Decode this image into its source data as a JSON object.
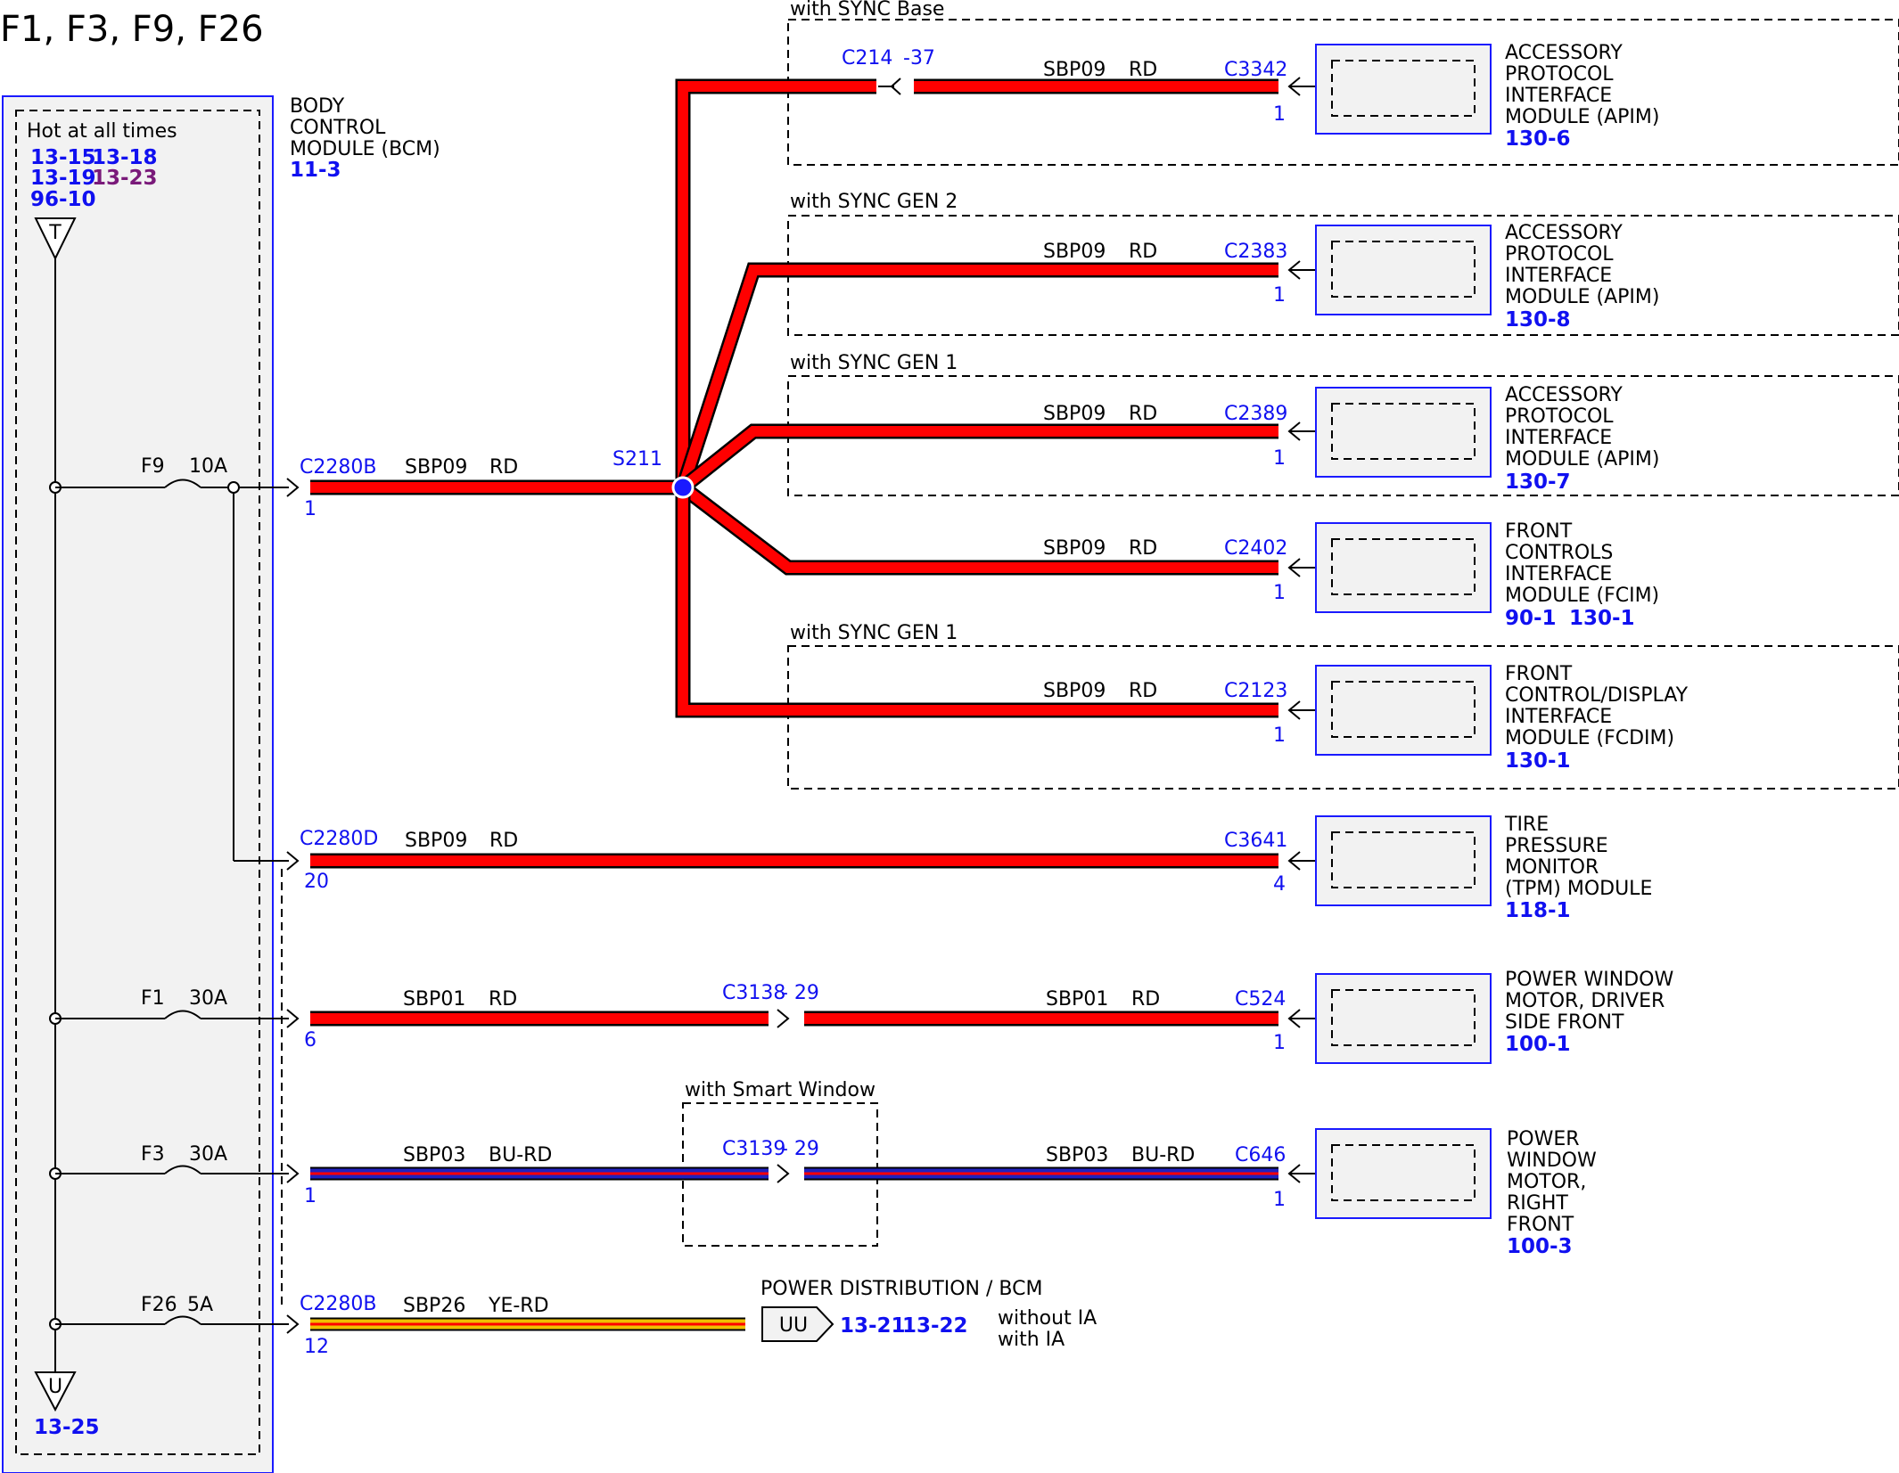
{
  "title": "F1, F3, F9, F26",
  "bcm": {
    "hot_label": "Hot at all times",
    "refs": [
      "13-15",
      "13-18",
      "13-19",
      "13-23",
      "96-10"
    ],
    "name_lines": [
      "BODY",
      "CONTROL",
      "MODULE (BCM)"
    ],
    "page_ref": "11-3",
    "top_terminal": "T",
    "bottom_terminal": "U",
    "bottom_ref": "13-25"
  },
  "fuses": [
    {
      "name": "F9",
      "rating": "10A"
    },
    {
      "name": "F1",
      "rating": "30A"
    },
    {
      "name": "F3",
      "rating": "30A"
    },
    {
      "name": "F26",
      "rating": "5A"
    }
  ],
  "splice": "S211",
  "option_groups": [
    "with SYNC Base",
    "with SYNC GEN 2",
    "with SYNC GEN 1",
    "with SYNC GEN 1",
    "with Smart Window"
  ],
  "branches": [
    {
      "circuit": "SBP09",
      "color": "RD",
      "inline_connector": "C214",
      "inline_pin": "-37",
      "connector": "C3342",
      "pin": "1",
      "module_lines": [
        "ACCESSORY",
        "PROTOCOL",
        "INTERFACE",
        "MODULE (APIM)"
      ],
      "refs": [
        "130-6"
      ]
    },
    {
      "circuit": "SBP09",
      "color": "RD",
      "connector": "C2383",
      "pin": "1",
      "module_lines": [
        "ACCESSORY",
        "PROTOCOL",
        "INTERFACE",
        "MODULE (APIM)"
      ],
      "refs": [
        "130-8"
      ]
    },
    {
      "circuit": "SBP09",
      "color": "RD",
      "connector": "C2389",
      "pin": "1",
      "module_lines": [
        "ACCESSORY",
        "PROTOCOL",
        "INTERFACE",
        "MODULE (APIM)"
      ],
      "refs": [
        "130-7"
      ]
    },
    {
      "circuit": "SBP09",
      "color": "RD",
      "connector": "C2402",
      "pin": "1",
      "module_lines": [
        "FRONT",
        "CONTROLS",
        "INTERFACE",
        "MODULE (FCIM)"
      ],
      "refs": [
        "90-1",
        "130-1"
      ]
    },
    {
      "circuit": "SBP09",
      "color": "RD",
      "connector": "C2123",
      "pin": "1",
      "module_lines": [
        "FRONT",
        "CONTROL/DISPLAY",
        "INTERFACE",
        "MODULE (FCDIM)"
      ],
      "refs": [
        "130-1"
      ]
    }
  ],
  "bcm_circuits": [
    {
      "bcm_connector": "C2280B",
      "bcm_pin": "1",
      "circuit": "SBP09",
      "color": "RD"
    },
    {
      "bcm_connector": "C2280D",
      "bcm_pin": "20",
      "circuit": "SBP09",
      "color": "RD",
      "connector": "C3641",
      "pin": "4",
      "module_lines": [
        "TIRE",
        "PRESSURE",
        "MONITOR",
        "(TPM) MODULE"
      ],
      "refs": [
        "118-1"
      ]
    },
    {
      "bcm_pin": "6",
      "circuit": "SBP01",
      "color": "RD",
      "inline_connector": "C3138",
      "inline_pin": "- 29",
      "circuit2": "SBP01",
      "color2": "RD",
      "connector": "C524",
      "pin": "1",
      "module_lines": [
        "POWER WINDOW",
        "MOTOR, DRIVER",
        "SIDE FRONT"
      ],
      "refs": [
        "100-1"
      ]
    },
    {
      "bcm_pin": "1",
      "circuit": "SBP03",
      "color": "BU-RD",
      "inline_connector": "C3139",
      "inline_pin": "- 29",
      "circuit2": "SBP03",
      "color2": "BU-RD",
      "connector": "C646",
      "pin": "1",
      "module_lines": [
        "POWER",
        "WINDOW",
        "MOTOR,",
        "RIGHT",
        "FRONT"
      ],
      "refs": [
        "100-3"
      ]
    },
    {
      "bcm_connector": "C2280B",
      "bcm_pin": "12",
      "circuit": "SBP26",
      "color": "YE-RD",
      "destination_title": "POWER DISTRIBUTION / BCM",
      "destination_tag": "UU",
      "refs": [
        "13-21",
        "13-22"
      ],
      "notes": [
        "without IA",
        "with IA"
      ]
    }
  ],
  "colors": {
    "red_wire": "#ff0000",
    "blue_wire": "#2020c0",
    "yellow_wire": "#f0c000",
    "text_blue": "#1010f0",
    "module_fill": "#f2f2f2",
    "purple_ref": "#7a1a7a"
  }
}
